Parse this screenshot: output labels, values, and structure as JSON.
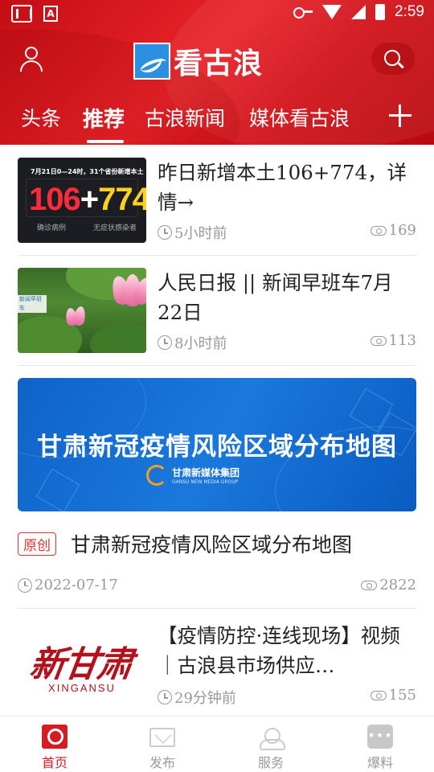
{
  "status_bar": {
    "time": "2:59",
    "app_icon_letter": "A"
  },
  "header": {
    "logo_text": "看古浪",
    "tabs": [
      {
        "label": "头条",
        "active": false
      },
      {
        "label": "推荐",
        "active": true
      },
      {
        "label": "古浪新闻",
        "active": false
      },
      {
        "label": "媒体看古浪",
        "active": false
      }
    ]
  },
  "feed": {
    "items": [
      {
        "title": "昨日新增本土106+774，详情→",
        "time": "5小时前",
        "views": "169",
        "thumb": {
          "top_text": "7月21日0—24时，31个省份新增本土",
          "num_red": "106",
          "plus": "+",
          "num_yellow": "774",
          "sub_left": "确诊病例",
          "sub_right": "无症状感染者"
        }
      },
      {
        "title": "人民日报 || 新闻早班车7月22日",
        "time": "8小时前",
        "views": "113",
        "thumb": {
          "tag": "新闻早班车"
        }
      },
      {
        "banner_title": "甘肃新冠疫情风险区域分布地图",
        "banner_org": "甘肃新媒体集团",
        "banner_org_en": "GANSU NEW MEDIA GROUP",
        "badge": "原创",
        "title": "甘肃新冠疫情风险区域分布地图",
        "date": "2022-07-17",
        "views": "2822"
      },
      {
        "title": "【疫情防控·连线现场】视频｜古浪县市场供应…",
        "time": "29分钟前",
        "views": "155",
        "thumb": {
          "cn": "新甘肃",
          "en": "XINGANSU"
        }
      }
    ]
  },
  "bottom_nav": [
    {
      "label": "首页",
      "icon": "home-icon",
      "active": true
    },
    {
      "label": "发布",
      "icon": "mail-icon",
      "active": false
    },
    {
      "label": "服务",
      "icon": "service-icon",
      "active": false
    },
    {
      "label": "爆料",
      "icon": "chat-icon",
      "active": false
    }
  ],
  "colors": {
    "brand_red": "#d51c22",
    "banner_blue": "#1a78dc"
  }
}
